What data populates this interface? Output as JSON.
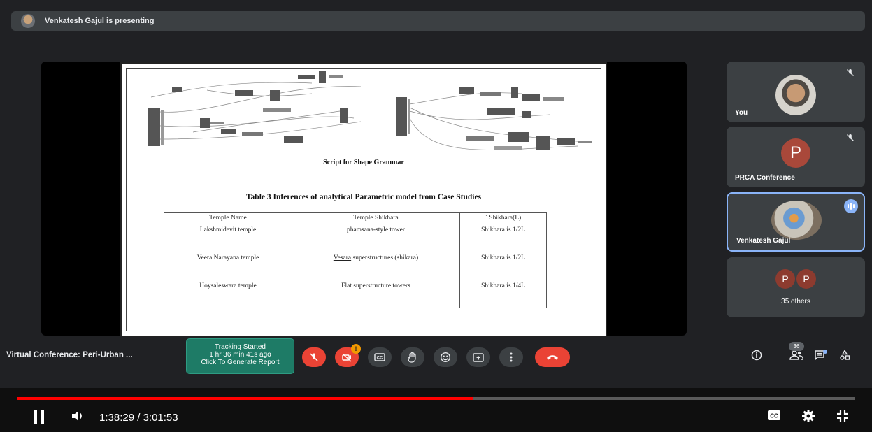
{
  "presenter_bar": {
    "text": "Venkatesh Gajul is presenting"
  },
  "slide": {
    "caption": "Script for Shape Grammar",
    "table_title": "Table 3 Inferences of analytical Parametric model from Case Studies",
    "table": {
      "headers": [
        "Temple Name",
        "Temple Shikhara",
        "` Shikhara(L)"
      ],
      "rows": [
        [
          "Lakshmidevit temple",
          "phamsana-style tower",
          "Shikhara is 1/2L"
        ],
        [
          "Veera Narayana temple",
          "Vesara superstructures (shikara)",
          "Shikhara is 1/2L"
        ],
        [
          "Hoysaleswara temple",
          "Flat superstructure towers",
          "Shikhara is 1/4L"
        ]
      ]
    }
  },
  "participants": {
    "you": {
      "label": "You",
      "muted": true
    },
    "prca": {
      "label": "PRCA Conference",
      "initial": "P",
      "muted": true
    },
    "venkatesh": {
      "label": "Venkatesh Gajul",
      "speaking": true
    },
    "others": {
      "label": "35 others",
      "initials": [
        "P",
        "P"
      ]
    }
  },
  "meeting": {
    "title": "Virtual Conference: Peri-Urban ...",
    "tracking": {
      "line1": "Tracking Started",
      "line2": "1 hr 36 min 41s ago",
      "line3": "Click To Generate Report"
    },
    "controls": {
      "mic_icon": "mic-off-icon",
      "camera_icon": "camera-off-icon",
      "camera_badge": "!",
      "captions_icon": "captions-icon",
      "hand_icon": "raise-hand-icon",
      "emoji_icon": "emoji-icon",
      "present_icon": "present-icon",
      "more_icon": "more-vert-icon",
      "end_icon": "end-call-icon"
    },
    "right_controls": {
      "info_icon": "info-icon",
      "people_icon": "people-icon",
      "people_count": "36",
      "chat_icon": "chat-icon",
      "activities_icon": "activities-icon"
    }
  },
  "player": {
    "current_time": "1:38:29",
    "separator": " / ",
    "duration": "3:01:53",
    "progress_fraction": 0.543,
    "play_state_icon": "pause-icon",
    "volume_icon": "volume-icon",
    "cc_icon": "subtitles-icon",
    "settings_icon": "settings-icon",
    "exit_fullscreen_icon": "exit-fullscreen-icon"
  },
  "colors": {
    "background": "#202124",
    "tile": "#3c4043",
    "danger": "#ea4335",
    "accent": "#8ab4f8",
    "tracking": "#1e7b66",
    "progress": "#ff0000"
  }
}
